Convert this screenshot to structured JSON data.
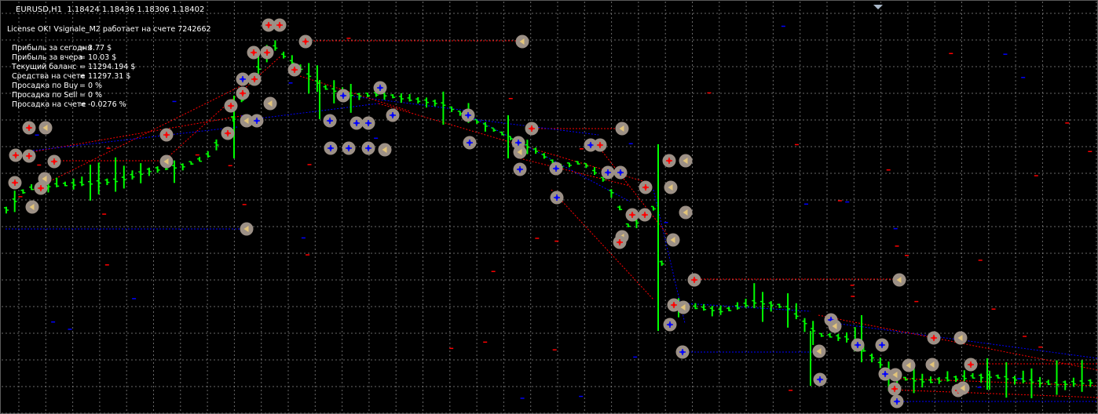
{
  "chart": {
    "header": "EURUSD,H1  1.18424 1.18436 1.18306 1.18402",
    "license": "License OK! Vsignale_M2 работает на счете 7242662"
  },
  "stats": [
    {
      "label": "Прибыль за сегодня",
      "value": "= 3.77 $"
    },
    {
      "label": "Прибыль за вчера",
      "value": "= 10.03 $"
    },
    {
      "label": "Текущий баланс",
      "value": "= 11294.194 $"
    },
    {
      "label": "Средства на счете",
      "value": "= 11297.31 $"
    },
    {
      "label": "Просадка по Buy",
      "value": "= 0 %"
    },
    {
      "label": "Просадка по Sell",
      "value": "= 0 %"
    },
    {
      "label": "Просадка на счете",
      "value": "= -0.0276 %"
    }
  ],
  "colors": {
    "background": "#000000",
    "grid": "#8c8c8c",
    "candle": "#00ff00",
    "buy_marker": "#0000ff",
    "sell_marker": "#ff0000",
    "marker_bg": "#9c9086",
    "close_arrow": "#e3c57a",
    "text": "#ffffff"
  },
  "icons": {
    "trade_open_buy": "blue-plus-on-circle-icon",
    "trade_open_sell": "red-plus-on-circle-icon",
    "trade_close": "left-arrow-on-circle-icon",
    "chart_shift": "triangle-down-icon"
  }
}
